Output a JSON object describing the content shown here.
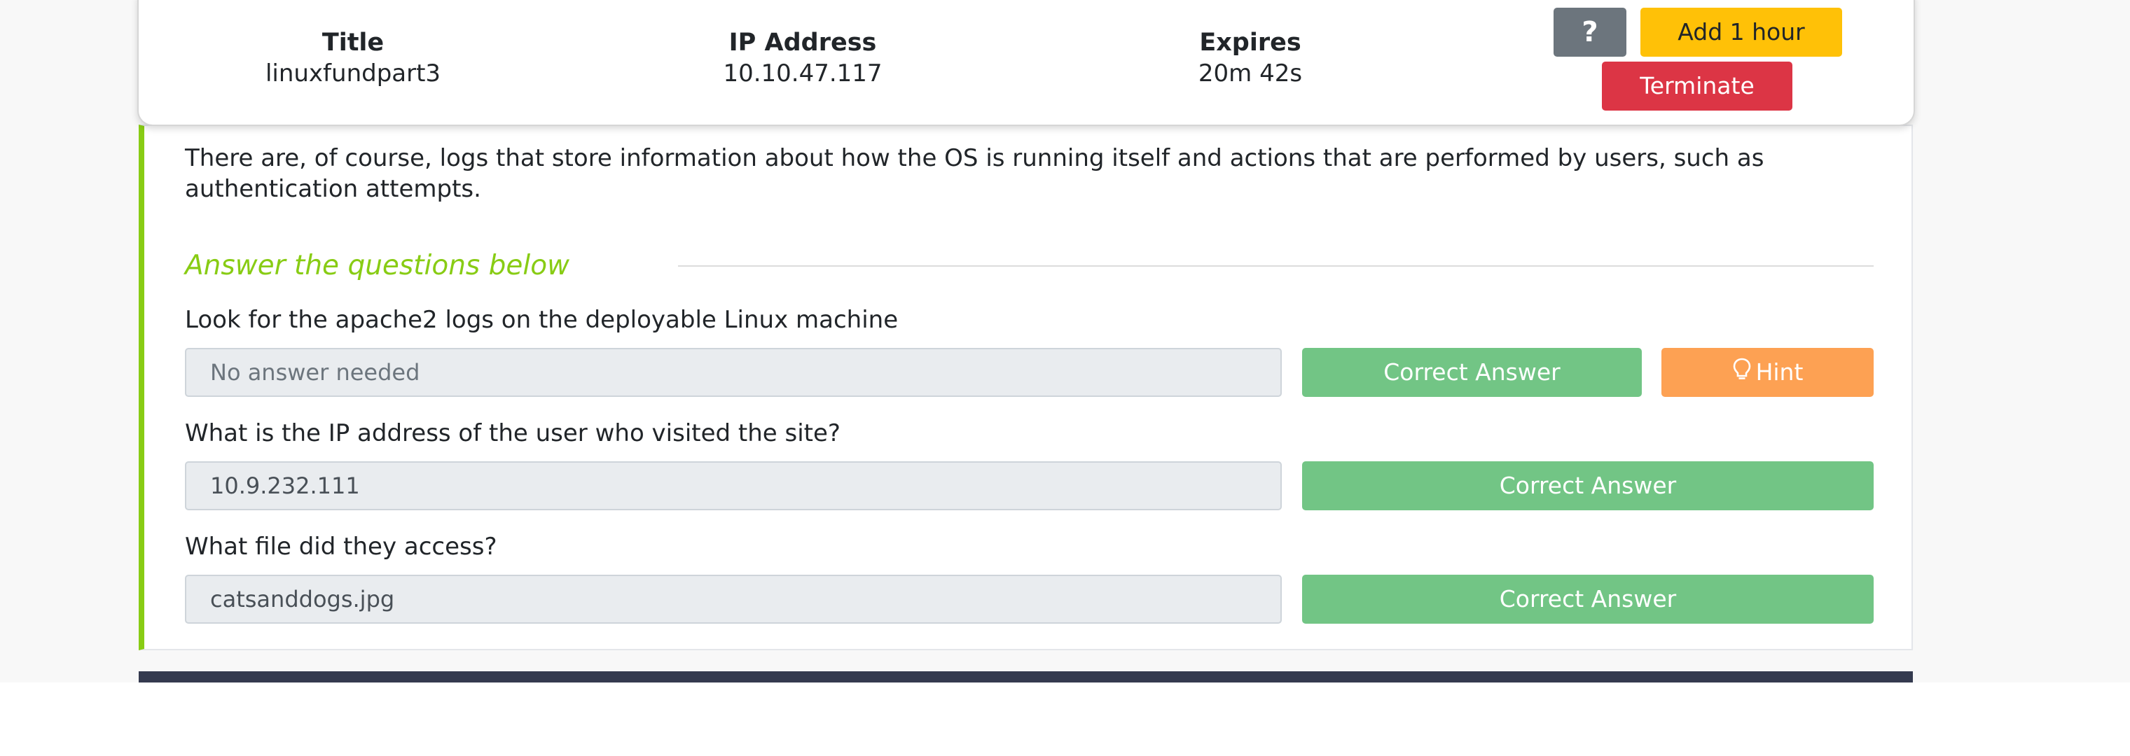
{
  "machine": {
    "title_label": "Title",
    "title_value": "linuxfundpart3",
    "ip_label": "IP Address",
    "ip_value": "10.10.47.117",
    "expires_label": "Expires",
    "expires_value": "20m 42s",
    "help_label": "?",
    "add_hour_label": "Add 1 hour",
    "terminate_label": "Terminate"
  },
  "task": {
    "text": "There are, of course, logs that store information about how the OS is running itself and actions that are performed by users, such as authentication attempts.",
    "section_title": "Answer the questions below",
    "questions": [
      {
        "question": "Look for the apache2 logs on the deployable Linux machine",
        "answer": "No answer needed",
        "answer_is_placeholder": true,
        "button": "Correct Answer",
        "hint": "Hint"
      },
      {
        "question": "What is the IP address of the user who visited the site?",
        "answer": "10.9.232.111",
        "button": "Correct Answer"
      },
      {
        "question": "What file did they access?",
        "answer": "catsanddogs.jpg",
        "button": "Correct Answer"
      }
    ]
  },
  "colors": {
    "accent_green": "#88cc14",
    "correct_button": "#72c585",
    "hint_button": "#fda153",
    "add_hour_button": "#ffc107",
    "terminate_button": "#dc3545",
    "help_button": "#6c757d",
    "footer": "#343a4f"
  },
  "icons": {
    "hint": "lightbulb-icon"
  }
}
